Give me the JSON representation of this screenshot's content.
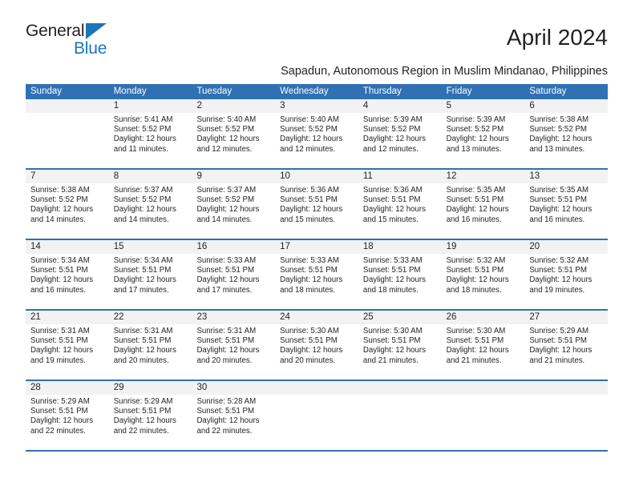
{
  "brand": {
    "name_part1": "General",
    "name_part2": "Blue",
    "accent_color": "#1b75bb"
  },
  "header": {
    "month_title": "April 2024",
    "location_subtitle": "Sapadun, Autonomous Region in Muslim Mindanao, Philippines"
  },
  "calendar": {
    "header_color": "#3071b4",
    "day_band_color": "#f2f2f2",
    "weekdays": [
      "Sunday",
      "Monday",
      "Tuesday",
      "Wednesday",
      "Thursday",
      "Friday",
      "Saturday"
    ],
    "weeks": [
      [
        {
          "date": "",
          "lines": [
            "",
            "",
            "",
            ""
          ]
        },
        {
          "date": "1",
          "lines": [
            "Sunrise: 5:41 AM",
            "Sunset: 5:52 PM",
            "Daylight: 12 hours",
            "and 11 minutes."
          ]
        },
        {
          "date": "2",
          "lines": [
            "Sunrise: 5:40 AM",
            "Sunset: 5:52 PM",
            "Daylight: 12 hours",
            "and 12 minutes."
          ]
        },
        {
          "date": "3",
          "lines": [
            "Sunrise: 5:40 AM",
            "Sunset: 5:52 PM",
            "Daylight: 12 hours",
            "and 12 minutes."
          ]
        },
        {
          "date": "4",
          "lines": [
            "Sunrise: 5:39 AM",
            "Sunset: 5:52 PM",
            "Daylight: 12 hours",
            "and 12 minutes."
          ]
        },
        {
          "date": "5",
          "lines": [
            "Sunrise: 5:39 AM",
            "Sunset: 5:52 PM",
            "Daylight: 12 hours",
            "and 13 minutes."
          ]
        },
        {
          "date": "6",
          "lines": [
            "Sunrise: 5:38 AM",
            "Sunset: 5:52 PM",
            "Daylight: 12 hours",
            "and 13 minutes."
          ]
        }
      ],
      [
        {
          "date": "7",
          "lines": [
            "Sunrise: 5:38 AM",
            "Sunset: 5:52 PM",
            "Daylight: 12 hours",
            "and 14 minutes."
          ]
        },
        {
          "date": "8",
          "lines": [
            "Sunrise: 5:37 AM",
            "Sunset: 5:52 PM",
            "Daylight: 12 hours",
            "and 14 minutes."
          ]
        },
        {
          "date": "9",
          "lines": [
            "Sunrise: 5:37 AM",
            "Sunset: 5:52 PM",
            "Daylight: 12 hours",
            "and 14 minutes."
          ]
        },
        {
          "date": "10",
          "lines": [
            "Sunrise: 5:36 AM",
            "Sunset: 5:51 PM",
            "Daylight: 12 hours",
            "and 15 minutes."
          ]
        },
        {
          "date": "11",
          "lines": [
            "Sunrise: 5:36 AM",
            "Sunset: 5:51 PM",
            "Daylight: 12 hours",
            "and 15 minutes."
          ]
        },
        {
          "date": "12",
          "lines": [
            "Sunrise: 5:35 AM",
            "Sunset: 5:51 PM",
            "Daylight: 12 hours",
            "and 16 minutes."
          ]
        },
        {
          "date": "13",
          "lines": [
            "Sunrise: 5:35 AM",
            "Sunset: 5:51 PM",
            "Daylight: 12 hours",
            "and 16 minutes."
          ]
        }
      ],
      [
        {
          "date": "14",
          "lines": [
            "Sunrise: 5:34 AM",
            "Sunset: 5:51 PM",
            "Daylight: 12 hours",
            "and 16 minutes."
          ]
        },
        {
          "date": "15",
          "lines": [
            "Sunrise: 5:34 AM",
            "Sunset: 5:51 PM",
            "Daylight: 12 hours",
            "and 17 minutes."
          ]
        },
        {
          "date": "16",
          "lines": [
            "Sunrise: 5:33 AM",
            "Sunset: 5:51 PM",
            "Daylight: 12 hours",
            "and 17 minutes."
          ]
        },
        {
          "date": "17",
          "lines": [
            "Sunrise: 5:33 AM",
            "Sunset: 5:51 PM",
            "Daylight: 12 hours",
            "and 18 minutes."
          ]
        },
        {
          "date": "18",
          "lines": [
            "Sunrise: 5:33 AM",
            "Sunset: 5:51 PM",
            "Daylight: 12 hours",
            "and 18 minutes."
          ]
        },
        {
          "date": "19",
          "lines": [
            "Sunrise: 5:32 AM",
            "Sunset: 5:51 PM",
            "Daylight: 12 hours",
            "and 18 minutes."
          ]
        },
        {
          "date": "20",
          "lines": [
            "Sunrise: 5:32 AM",
            "Sunset: 5:51 PM",
            "Daylight: 12 hours",
            "and 19 minutes."
          ]
        }
      ],
      [
        {
          "date": "21",
          "lines": [
            "Sunrise: 5:31 AM",
            "Sunset: 5:51 PM",
            "Daylight: 12 hours",
            "and 19 minutes."
          ]
        },
        {
          "date": "22",
          "lines": [
            "Sunrise: 5:31 AM",
            "Sunset: 5:51 PM",
            "Daylight: 12 hours",
            "and 20 minutes."
          ]
        },
        {
          "date": "23",
          "lines": [
            "Sunrise: 5:31 AM",
            "Sunset: 5:51 PM",
            "Daylight: 12 hours",
            "and 20 minutes."
          ]
        },
        {
          "date": "24",
          "lines": [
            "Sunrise: 5:30 AM",
            "Sunset: 5:51 PM",
            "Daylight: 12 hours",
            "and 20 minutes."
          ]
        },
        {
          "date": "25",
          "lines": [
            "Sunrise: 5:30 AM",
            "Sunset: 5:51 PM",
            "Daylight: 12 hours",
            "and 21 minutes."
          ]
        },
        {
          "date": "26",
          "lines": [
            "Sunrise: 5:30 AM",
            "Sunset: 5:51 PM",
            "Daylight: 12 hours",
            "and 21 minutes."
          ]
        },
        {
          "date": "27",
          "lines": [
            "Sunrise: 5:29 AM",
            "Sunset: 5:51 PM",
            "Daylight: 12 hours",
            "and 21 minutes."
          ]
        }
      ],
      [
        {
          "date": "28",
          "lines": [
            "Sunrise: 5:29 AM",
            "Sunset: 5:51 PM",
            "Daylight: 12 hours",
            "and 22 minutes."
          ]
        },
        {
          "date": "29",
          "lines": [
            "Sunrise: 5:29 AM",
            "Sunset: 5:51 PM",
            "Daylight: 12 hours",
            "and 22 minutes."
          ]
        },
        {
          "date": "30",
          "lines": [
            "Sunrise: 5:28 AM",
            "Sunset: 5:51 PM",
            "Daylight: 12 hours",
            "and 22 minutes."
          ]
        },
        {
          "date": "",
          "lines": [
            "",
            "",
            "",
            ""
          ]
        },
        {
          "date": "",
          "lines": [
            "",
            "",
            "",
            ""
          ]
        },
        {
          "date": "",
          "lines": [
            "",
            "",
            "",
            ""
          ]
        },
        {
          "date": "",
          "lines": [
            "",
            "",
            "",
            ""
          ]
        }
      ]
    ]
  }
}
